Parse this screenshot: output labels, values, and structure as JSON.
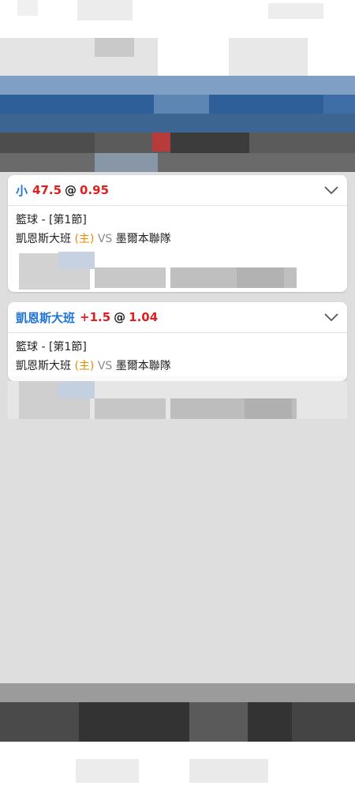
{
  "bets": [
    {
      "selection": "小",
      "line": "47.5",
      "at": "@",
      "odds": "0.95",
      "sport_period": "籃球 - [第1節]",
      "home_team": "凱恩斯大班",
      "home_tag": "(主)",
      "vs": "VS",
      "away_team": "墨爾本聯隊"
    },
    {
      "selection": "凱恩斯大班",
      "line": "+1.5",
      "at": "@",
      "odds": "1.04",
      "sport_period": "籃球 - [第1節]",
      "home_team": "凱恩斯大班",
      "home_tag": "(主)",
      "vs": "VS",
      "away_team": "墨爾本聯隊"
    }
  ],
  "colors": {
    "selection": "#1f74d6",
    "odds": "#e02020",
    "home_tag": "#e68a00",
    "vs": "#888888"
  },
  "icons": {
    "expand": "chevron-down-icon"
  }
}
